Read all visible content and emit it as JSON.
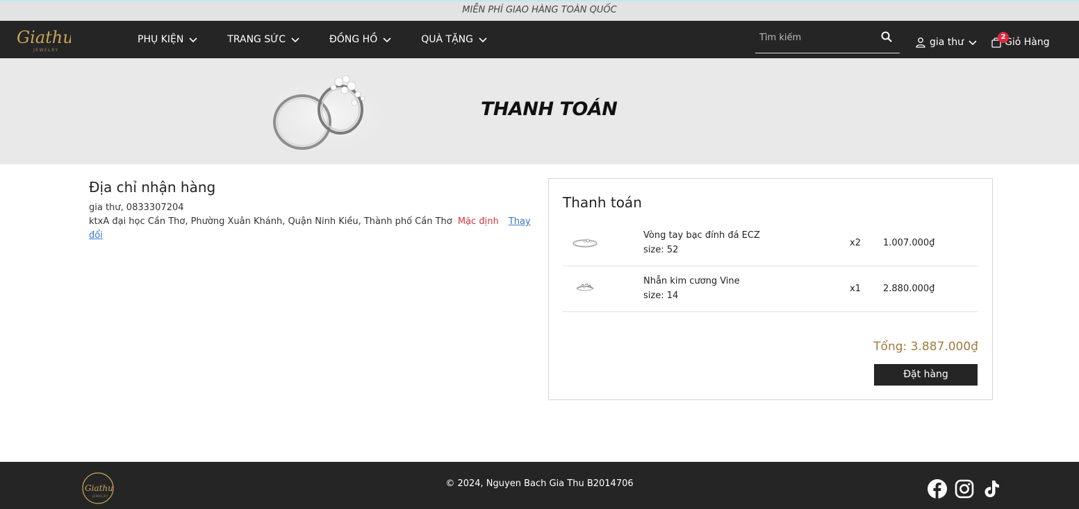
{
  "topbar": {
    "text": "MIỄN PHÍ GIAO HÀNG TOÀN QUỐC"
  },
  "logo": {
    "script_text": "Giathu",
    "sub_text": "JEWELRY"
  },
  "nav": {
    "menu": [
      {
        "label": "PHỤ KIỆN"
      },
      {
        "label": "TRANG SỨC"
      },
      {
        "label": "ĐỒNG HỒ"
      },
      {
        "label": "QUÀ TẶNG"
      }
    ],
    "search_placeholder": "Tìm kiếm",
    "account_name": "gia thư",
    "cart_label": "Giỏ Hàng",
    "cart_count": "2"
  },
  "banner": {
    "title": "THANH TOÁN"
  },
  "address": {
    "heading": "Địa chỉ nhận hàng",
    "contact": "gia thư, 0833307204",
    "street": "ktxA đại học Cần Thơ, Phường Xuân Khánh, Quận Ninh Kiều, Thành phố Cần Thơ",
    "default_label": "Mặc định",
    "change_link": "Thay đổi"
  },
  "checkout": {
    "heading": "Thanh toán",
    "items": [
      {
        "name": "Vòng tay bạc đính đá ECZ",
        "size": "size: 52",
        "qty": "x2",
        "price": "1.007.000₫",
        "icon": "bracelet-thumbnail"
      },
      {
        "name": "Nhẫn kim cương Vine",
        "size": "size: 14",
        "qty": "x1",
        "price": "2.880.000₫",
        "icon": "ring-thumbnail"
      }
    ],
    "total": "Tổng: 3.887.000₫",
    "order_button": "Đặt hàng"
  },
  "footer": {
    "copyright": "© 2024, Nguyen Bach Gia Thu B2014706",
    "social": [
      "facebook-icon",
      "instagram-icon",
      "tiktok-icon"
    ]
  },
  "colors": {
    "dark": "#252525",
    "accent_gold": "#a07a3a",
    "badge": "#e0283f",
    "link": "#3a73d8",
    "default_red": "#d9323f"
  }
}
